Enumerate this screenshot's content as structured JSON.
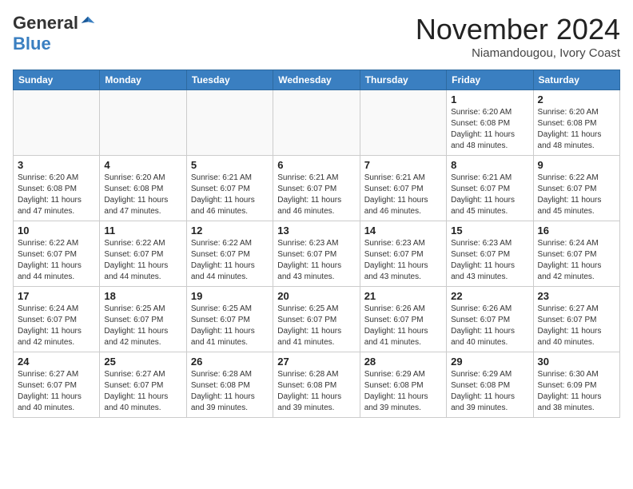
{
  "logo": {
    "general": "General",
    "blue": "Blue"
  },
  "title": "November 2024",
  "location": "Niamandougou, Ivory Coast",
  "days_of_week": [
    "Sunday",
    "Monday",
    "Tuesday",
    "Wednesday",
    "Thursday",
    "Friday",
    "Saturday"
  ],
  "weeks": [
    [
      {
        "day": "",
        "info": ""
      },
      {
        "day": "",
        "info": ""
      },
      {
        "day": "",
        "info": ""
      },
      {
        "day": "",
        "info": ""
      },
      {
        "day": "",
        "info": ""
      },
      {
        "day": "1",
        "info": "Sunrise: 6:20 AM\nSunset: 6:08 PM\nDaylight: 11 hours and 48 minutes."
      },
      {
        "day": "2",
        "info": "Sunrise: 6:20 AM\nSunset: 6:08 PM\nDaylight: 11 hours and 48 minutes."
      }
    ],
    [
      {
        "day": "3",
        "info": "Sunrise: 6:20 AM\nSunset: 6:08 PM\nDaylight: 11 hours and 47 minutes."
      },
      {
        "day": "4",
        "info": "Sunrise: 6:20 AM\nSunset: 6:08 PM\nDaylight: 11 hours and 47 minutes."
      },
      {
        "day": "5",
        "info": "Sunrise: 6:21 AM\nSunset: 6:07 PM\nDaylight: 11 hours and 46 minutes."
      },
      {
        "day": "6",
        "info": "Sunrise: 6:21 AM\nSunset: 6:07 PM\nDaylight: 11 hours and 46 minutes."
      },
      {
        "day": "7",
        "info": "Sunrise: 6:21 AM\nSunset: 6:07 PM\nDaylight: 11 hours and 46 minutes."
      },
      {
        "day": "8",
        "info": "Sunrise: 6:21 AM\nSunset: 6:07 PM\nDaylight: 11 hours and 45 minutes."
      },
      {
        "day": "9",
        "info": "Sunrise: 6:22 AM\nSunset: 6:07 PM\nDaylight: 11 hours and 45 minutes."
      }
    ],
    [
      {
        "day": "10",
        "info": "Sunrise: 6:22 AM\nSunset: 6:07 PM\nDaylight: 11 hours and 44 minutes."
      },
      {
        "day": "11",
        "info": "Sunrise: 6:22 AM\nSunset: 6:07 PM\nDaylight: 11 hours and 44 minutes."
      },
      {
        "day": "12",
        "info": "Sunrise: 6:22 AM\nSunset: 6:07 PM\nDaylight: 11 hours and 44 minutes."
      },
      {
        "day": "13",
        "info": "Sunrise: 6:23 AM\nSunset: 6:07 PM\nDaylight: 11 hours and 43 minutes."
      },
      {
        "day": "14",
        "info": "Sunrise: 6:23 AM\nSunset: 6:07 PM\nDaylight: 11 hours and 43 minutes."
      },
      {
        "day": "15",
        "info": "Sunrise: 6:23 AM\nSunset: 6:07 PM\nDaylight: 11 hours and 43 minutes."
      },
      {
        "day": "16",
        "info": "Sunrise: 6:24 AM\nSunset: 6:07 PM\nDaylight: 11 hours and 42 minutes."
      }
    ],
    [
      {
        "day": "17",
        "info": "Sunrise: 6:24 AM\nSunset: 6:07 PM\nDaylight: 11 hours and 42 minutes."
      },
      {
        "day": "18",
        "info": "Sunrise: 6:25 AM\nSunset: 6:07 PM\nDaylight: 11 hours and 42 minutes."
      },
      {
        "day": "19",
        "info": "Sunrise: 6:25 AM\nSunset: 6:07 PM\nDaylight: 11 hours and 41 minutes."
      },
      {
        "day": "20",
        "info": "Sunrise: 6:25 AM\nSunset: 6:07 PM\nDaylight: 11 hours and 41 minutes."
      },
      {
        "day": "21",
        "info": "Sunrise: 6:26 AM\nSunset: 6:07 PM\nDaylight: 11 hours and 41 minutes."
      },
      {
        "day": "22",
        "info": "Sunrise: 6:26 AM\nSunset: 6:07 PM\nDaylight: 11 hours and 40 minutes."
      },
      {
        "day": "23",
        "info": "Sunrise: 6:27 AM\nSunset: 6:07 PM\nDaylight: 11 hours and 40 minutes."
      }
    ],
    [
      {
        "day": "24",
        "info": "Sunrise: 6:27 AM\nSunset: 6:07 PM\nDaylight: 11 hours and 40 minutes."
      },
      {
        "day": "25",
        "info": "Sunrise: 6:27 AM\nSunset: 6:07 PM\nDaylight: 11 hours and 40 minutes."
      },
      {
        "day": "26",
        "info": "Sunrise: 6:28 AM\nSunset: 6:08 PM\nDaylight: 11 hours and 39 minutes."
      },
      {
        "day": "27",
        "info": "Sunrise: 6:28 AM\nSunset: 6:08 PM\nDaylight: 11 hours and 39 minutes."
      },
      {
        "day": "28",
        "info": "Sunrise: 6:29 AM\nSunset: 6:08 PM\nDaylight: 11 hours and 39 minutes."
      },
      {
        "day": "29",
        "info": "Sunrise: 6:29 AM\nSunset: 6:08 PM\nDaylight: 11 hours and 39 minutes."
      },
      {
        "day": "30",
        "info": "Sunrise: 6:30 AM\nSunset: 6:09 PM\nDaylight: 11 hours and 38 minutes."
      }
    ]
  ]
}
